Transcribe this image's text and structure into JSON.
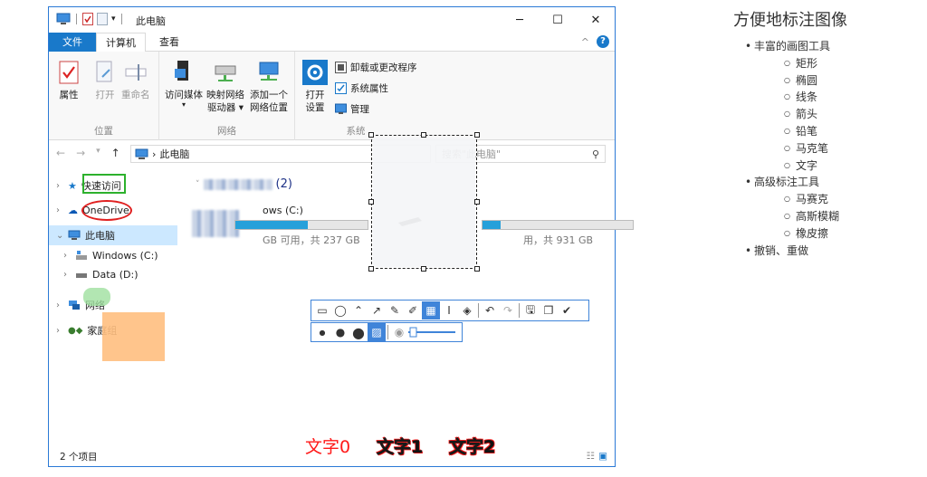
{
  "window": {
    "title": "此电脑",
    "minimize": "─",
    "maximize": "☐",
    "close": "✕"
  },
  "tabs": {
    "file": "文件",
    "computer": "计算机",
    "view": "查看",
    "collapse": "^",
    "help": "?"
  },
  "ribbon": {
    "location": {
      "label": "位置",
      "properties": "属性",
      "open": "打开",
      "rename": "重命名"
    },
    "network": {
      "label": "网络",
      "media_line1": "访问媒体",
      "media_line2": "▾",
      "map_line1": "映射网络",
      "map_line2": "驱动器 ▾",
      "add_line1": "添加一个",
      "add_line2": "网络位置"
    },
    "system": {
      "label": "系统",
      "settings_line1": "打开",
      "settings_line2": "设置",
      "uninstall": "卸载或更改程序",
      "sysprops": "系统属性",
      "manage": "管理"
    }
  },
  "address": {
    "back": "←",
    "forward": "→",
    "recent": "▾",
    "up": "↑",
    "separator": "›",
    "path": "此电脑",
    "search_placeholder": "搜索\"此电脑\"",
    "search_icon": "⚲"
  },
  "sidebar": {
    "items": [
      {
        "label": "快速访问",
        "chev": "›"
      },
      {
        "label": "OneDrive",
        "chev": "›"
      },
      {
        "label": "此电脑",
        "chev": "⌄"
      },
      {
        "label": "Windows (C:)",
        "chev": "›"
      },
      {
        "label": "Data (D:)",
        "chev": "›"
      },
      {
        "label": "网络",
        "chev": "›"
      },
      {
        "label": "家庭组",
        "chev": "›"
      }
    ]
  },
  "content": {
    "group_count": "(2)",
    "drive_c": {
      "label": "ows (C:)",
      "info": "GB 可用，共 237 GB",
      "used": 0.55
    },
    "drive_d": {
      "info": "用，共 931 GB",
      "used": 0.12
    }
  },
  "status": {
    "items": "2 个项目"
  },
  "annotations": {
    "text0": "文字0",
    "text1": "文字1",
    "text2": "文字2"
  },
  "features": {
    "title": "方便地标注图像",
    "sections": [
      {
        "label": "丰富的画图工具",
        "children": [
          "矩形",
          "椭圆",
          "线条",
          "箭头",
          "铅笔",
          "马克笔",
          "文字"
        ]
      },
      {
        "label": "高级标注工具",
        "children": [
          "马赛克",
          "高斯模糊",
          "橡皮擦"
        ]
      },
      {
        "label": "撤销、重做",
        "children": []
      }
    ]
  },
  "colors": {
    "accent": "#1979ca",
    "annot_red": "#e02020",
    "annot_green": "#2db12d",
    "toolbar_blue": "#3f84d9",
    "highlight_orange": "#ffbf7f"
  }
}
